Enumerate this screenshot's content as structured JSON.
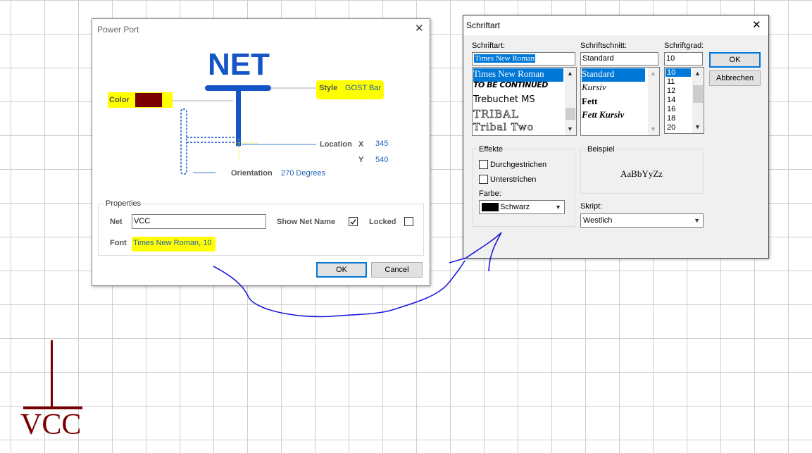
{
  "power_port": {
    "title": "Power Port",
    "preview": {
      "net_label": "NET",
      "color_label": "Color",
      "color_swatch": "#7a0000",
      "style_label": "Style",
      "style_value": "GOST Bar",
      "location_label": "Location",
      "x_label": "X",
      "x_value": "345",
      "y_label": "Y",
      "y_value": "540",
      "orientation_label": "Orientation",
      "orientation_value": "270 Degrees"
    },
    "properties": {
      "group_label": "Properties",
      "net_label": "Net",
      "net_value": "VCC",
      "show_net_name_label": "Show Net Name",
      "show_net_name_checked": true,
      "locked_label": "Locked",
      "locked_checked": false,
      "font_label": "Font",
      "font_value": "Times New Roman, 10"
    },
    "ok_label": "OK",
    "cancel_label": "Cancel"
  },
  "schriftart": {
    "title": "Schriftart",
    "font_label": "Schriftart:",
    "font_value": "Times New Roman",
    "fonts": [
      "Times New Roman",
      "TO BE CONTINUED",
      "Trebuchet MS",
      "TRIBAL",
      "Tribal Two"
    ],
    "style_label": "Schriftschnitt:",
    "style_value": "Standard",
    "styles": [
      "Standard",
      "Kursiv",
      "Fett",
      "Fett Kursiv"
    ],
    "size_label": "Schriftgrad:",
    "size_value": "10",
    "sizes": [
      "10",
      "11",
      "12",
      "14",
      "16",
      "18",
      "20"
    ],
    "ok_label": "OK",
    "cancel_label": "Abbrechen",
    "effects_label": "Effekte",
    "strikeout_label": "Durchgestrichen",
    "underline_label": "Unterstrichen",
    "color_label": "Farbe:",
    "color_value": "Schwarz",
    "color_swatch": "#000000",
    "sample_label": "Beispiel",
    "sample_text": "AaBbYyZz",
    "script_label": "Skript:",
    "script_value": "Westlich"
  },
  "canvas": {
    "vcc_label": "VCC",
    "symbol_color": "#7a0000",
    "annotation_color": "#1a1adb"
  }
}
